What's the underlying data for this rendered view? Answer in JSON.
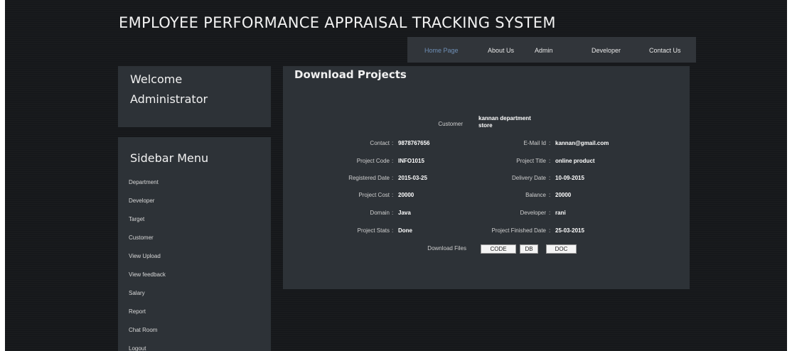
{
  "header": {
    "title": "EMPLOYEE PERFORMANCE APPRAISAL TRACKING SYSTEM"
  },
  "nav": {
    "items": [
      "Home Page",
      "About Us",
      "Admin",
      "Developer",
      "Contact Us"
    ],
    "active_index": 0
  },
  "welcome": {
    "line1": "Welcome",
    "line2": "Administrator"
  },
  "sidebar": {
    "title": "Sidebar Menu",
    "items": [
      "Department",
      "Developer",
      "Target",
      "Customer",
      "View Upload",
      "View feedback",
      "Salary",
      "Report",
      "Chat Room",
      "Logout"
    ]
  },
  "content": {
    "title": "Download Projects",
    "customer": {
      "label": "Customer",
      "value": "kannan department store"
    },
    "fields": {
      "contact": {
        "label": "Contact",
        "value": "9878767656"
      },
      "email": {
        "label": "E-Mail Id",
        "value": "kannan@gmail.com"
      },
      "project_code": {
        "label": "Project Code",
        "value": "INFO1015"
      },
      "project_title": {
        "label": "Project Title",
        "value": "online product"
      },
      "registered_date": {
        "label": "Registered Date",
        "value": "2015-03-25"
      },
      "delivery_date": {
        "label": "Delivery Date",
        "value": "10-09-2015"
      },
      "project_cost": {
        "label": "Project Cost",
        "value": "20000"
      },
      "balance": {
        "label": "Balance",
        "value": "20000"
      },
      "domain": {
        "label": "Domain",
        "value": "Java"
      },
      "developer": {
        "label": "Developer",
        "value": "rani"
      },
      "project_status": {
        "label": "Project Stats",
        "value": "Done"
      },
      "finished_date": {
        "label": "Project Finished Date",
        "value": "25-03-2015"
      }
    },
    "download": {
      "label": "Download Files",
      "buttons": [
        "CODE",
        "DB",
        "DOC"
      ]
    },
    "separator": ":"
  },
  "colors": {
    "background": "#16181b",
    "panel": "#2d3237",
    "nav_bar": "#31353a",
    "nav_active": "#6f8fb6",
    "text": "#f2f2f2"
  }
}
